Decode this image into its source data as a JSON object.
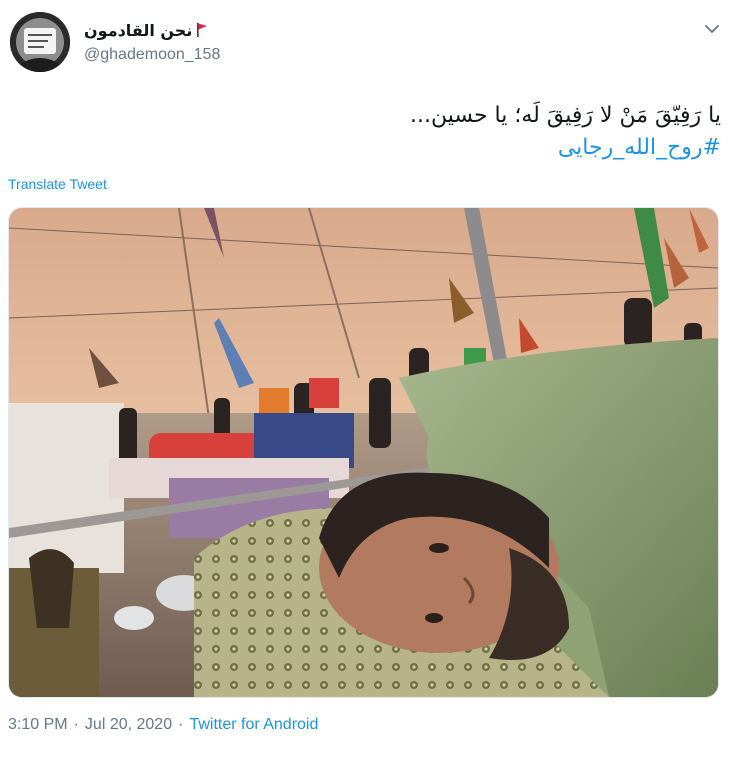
{
  "author": {
    "display_name": "نحن القادمون",
    "handle": "@ghademoon_158"
  },
  "tweet": {
    "text": "یا رَفِیّقَ مَنْ لا رَفِیقَ لَه؛ یا حسین...",
    "hashtag": "#روح_الله_رجایی",
    "translate_label": "Translate Tweet"
  },
  "meta": {
    "time": "3:10 PM",
    "separator": "·",
    "date": "Jul 20, 2020",
    "source": "Twitter for Android"
  },
  "colors": {
    "link": "#1b95e0",
    "secondary_text": "#657786",
    "flag": "#e0245e"
  },
  "icons": {
    "flag": "red-flag-icon",
    "menu": "chevron-down-icon"
  }
}
